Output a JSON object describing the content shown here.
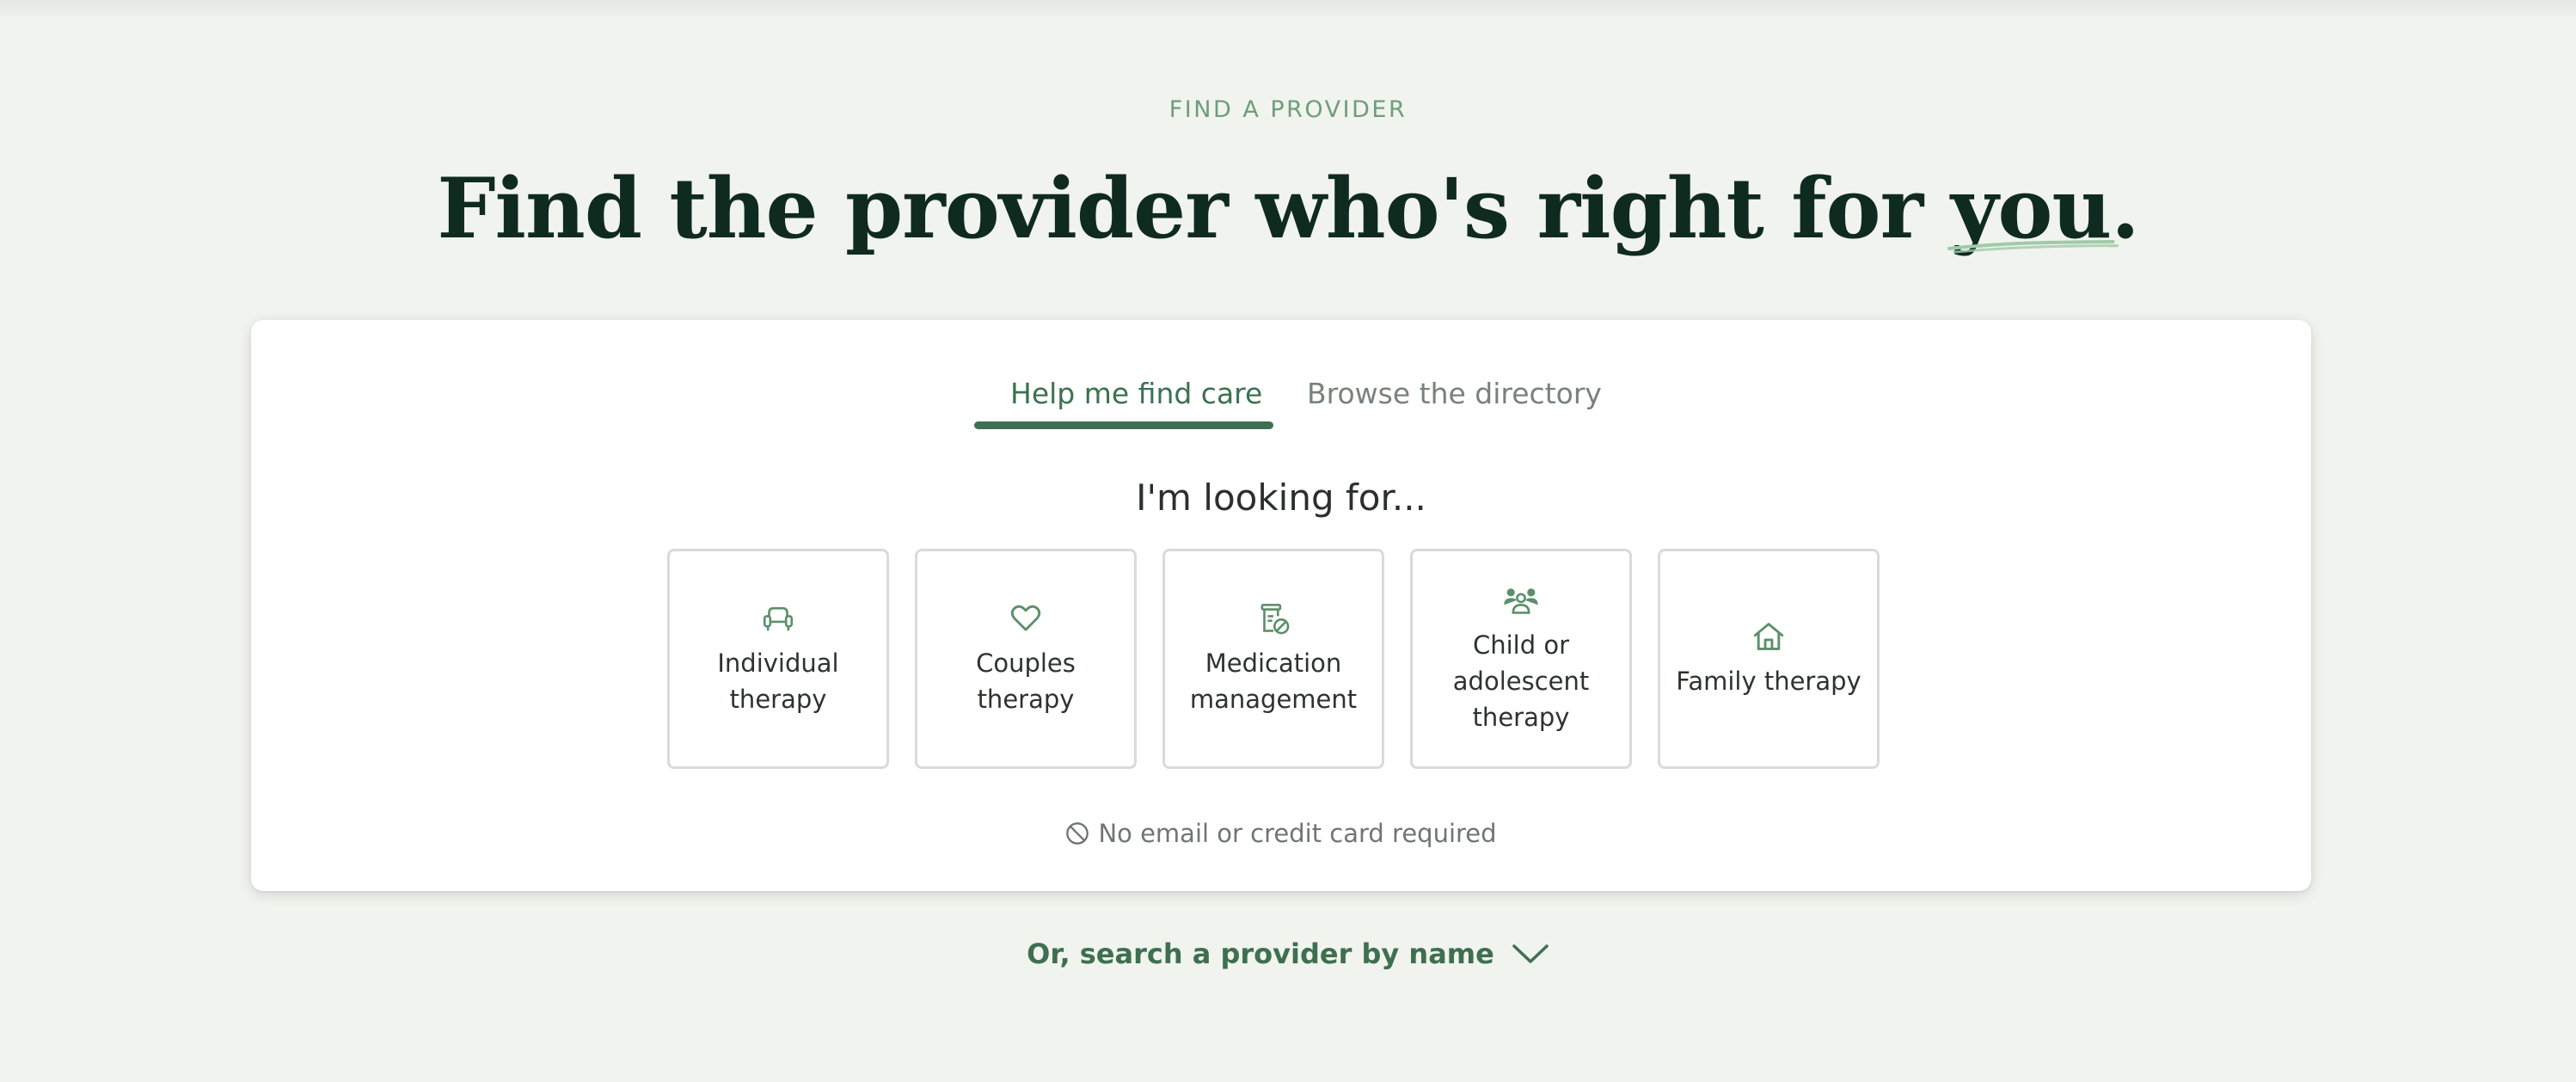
{
  "eyebrow": "FIND A PROVIDER",
  "headline": {
    "main": "Find the provider who's right for ",
    "accent": "you",
    "end": "."
  },
  "tabs": [
    {
      "label": "Help me find care",
      "active": true
    },
    {
      "label": "Browse the directory",
      "active": false
    }
  ],
  "prompt": "I'm looking for...",
  "options": [
    {
      "label": "Individual therapy",
      "icon": "armchair-icon"
    },
    {
      "label": "Couples therapy",
      "icon": "heart-icon"
    },
    {
      "label": "Medication management",
      "icon": "pill-bottle-icon"
    },
    {
      "label": "Child or adolescent therapy",
      "icon": "family-group-icon"
    },
    {
      "label": "Family therapy",
      "icon": "house-icon"
    }
  ],
  "note": "No email or credit card required",
  "search_link": "Or, search a provider by name",
  "colors": {
    "background": "#f1f3ee",
    "accent_green": "#3e7050",
    "eyebrow_green": "#6e9e79",
    "headline": "#0f2b1f"
  }
}
